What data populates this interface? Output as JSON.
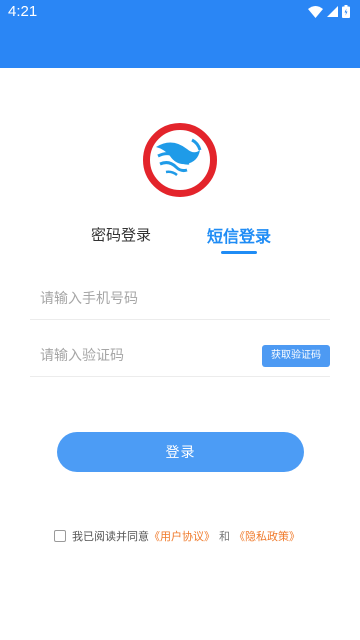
{
  "status_bar": {
    "time": "4:21",
    "icons": [
      "wifi-icon",
      "cellular-signal-icon",
      "battery-icon"
    ]
  },
  "colors": {
    "header": "#2a86f5",
    "accent": "#1f8cf5",
    "button": "#4c9cf5",
    "link": "#f07a2b",
    "logo_red": "#e3242b",
    "logo_blue": "#1f9be8"
  },
  "logo": {
    "icon": "bird-circle-logo"
  },
  "tabs": [
    {
      "label": "密码登录",
      "active": false
    },
    {
      "label": "短信登录",
      "active": true
    }
  ],
  "form": {
    "phone_placeholder": "请输入手机号码",
    "code_placeholder": "请输入验证码",
    "get_code_label": "获取验证码",
    "login_label": "登录"
  },
  "agreement": {
    "checked": false,
    "prefix": "我已阅读并同意",
    "user_agreement": "《用户协议》",
    "and": "和",
    "privacy_policy": "《隐私政策》"
  }
}
